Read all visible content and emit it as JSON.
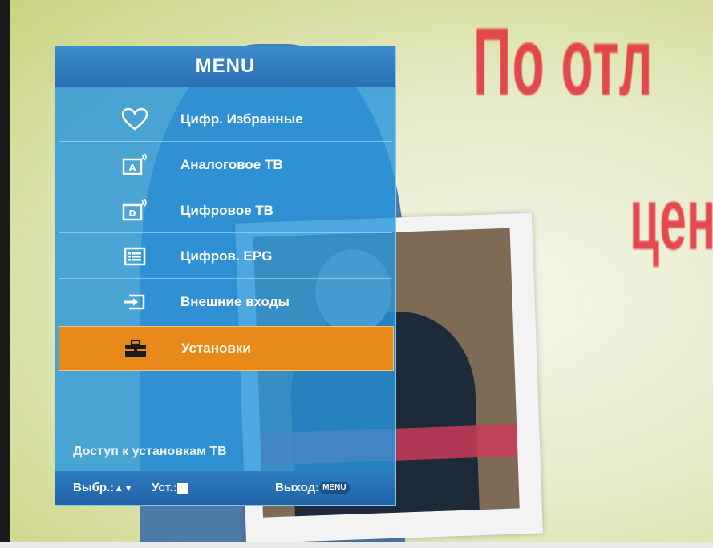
{
  "menu": {
    "title": "MENU",
    "items": [
      {
        "label": "Цифр. Избранные",
        "icon": "heart-icon",
        "selected": false
      },
      {
        "label": "Аналоговое ТВ",
        "icon": "analog-tv-icon",
        "selected": false
      },
      {
        "label": "Цифровое ТВ",
        "icon": "digital-tv-icon",
        "selected": false
      },
      {
        "label": "Цифров. EPG",
        "icon": "epg-list-icon",
        "selected": false
      },
      {
        "label": "Внешние входы",
        "icon": "input-source-icon",
        "selected": false
      },
      {
        "label": "Установки",
        "icon": "toolbox-icon",
        "selected": true
      }
    ],
    "description": "Доступ к установкам ТВ",
    "footer": {
      "select_label": "Выбр.:",
      "set_label": "Уст.:",
      "exit_label": "Выход:",
      "exit_key": "MENU"
    }
  },
  "background": {
    "banner_line1": "По отл",
    "banner_line2": "цен"
  },
  "colors": {
    "menu_blue": "#2896dc",
    "header_blue": "#2a6fb3",
    "selected_orange": "#e88a1a"
  }
}
